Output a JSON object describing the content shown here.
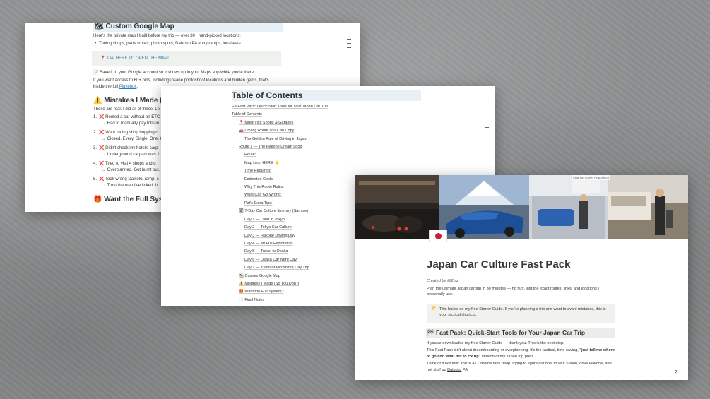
{
  "card1": {
    "heading": "Custom Google Map",
    "heading_icon": "map-icon",
    "intro": "Here's the private map I built before my trip — over 30+ hand-picked locations:",
    "bullet": "Tuning shops, parts stores, photo spots, Daikoku PA entry ramps, local eats",
    "callout_link": "TAP HERE TO OPEN THE MAP!",
    "save_text": "Save it to your Google account so it shows up in your Maps app while you're there.",
    "access_text": "If you want access to 60+ pins, including insane photoshoot locations and hidden gems, that's",
    "access_text2_prefix": "inside the full ",
    "access_link": "Playbook",
    "access_text2_suffix": ".",
    "mistakes_heading": "Mistakes I Made (So",
    "mistakes_intro": "These are real. I did all of these. Le",
    "mistakes": [
      {
        "num": "1.",
        "text": "Rented a car without an ETC",
        "sub": "→ Had to manually pay tolls in"
      },
      {
        "num": "2.",
        "text": "Went tuning shop hopping o",
        "sub": "→ Closed. Every. Single. One. C"
      },
      {
        "num": "3.",
        "text": "Didn't check my hotel's carp",
        "sub": "→ Underground carpark was 1"
      },
      {
        "num": "4.",
        "text": "Tried to visit 4 shops and d",
        "sub": "→ Overplanned. Got burnt out."
      },
      {
        "num": "5.",
        "text": "Took wrong Daikoku ramp, c",
        "sub": "→ Trust the map I've linked. It'"
      }
    ],
    "full_system_heading": "Want the Full Systen"
  },
  "card2": {
    "title": "Table of Contents",
    "items": [
      {
        "text": "🏎 Fast Pack: Quick-Start Tools for Your Japan Car Trip",
        "level": 0
      },
      {
        "text": "Table of Contents",
        "level": 0
      },
      {
        "text": "📍 Must-Visit Shops & Garages",
        "level": 1
      },
      {
        "text": "🚗 Driving Route You Can Copy",
        "level": 1
      },
      {
        "text": "The Golden Rule of Driving in Japan",
        "level": 2
      },
      {
        "text": "Route 1 — The Hakone Dream Loop",
        "level": 1
      },
      {
        "text": "Route:",
        "level": 2
      },
      {
        "text": "Map Link: HERE 👈",
        "level": 2
      },
      {
        "text": "Time Required:",
        "level": 2
      },
      {
        "text": "Estimated Costs:",
        "level": 2
      },
      {
        "text": "Why This Route Rules:",
        "level": 2
      },
      {
        "text": "What Can Go Wrong:",
        "level": 2
      },
      {
        "text": "Pat's Extra Tips:",
        "level": 2
      },
      {
        "text": "🗓 7-Day Car Culture Itinerary (Sample)",
        "level": 1
      },
      {
        "text": "Day 1 — Land in Tokyo",
        "level": 2
      },
      {
        "text": "Day 2 — Tokyo Car Culture",
        "level": 2
      },
      {
        "text": "Day 3 — Hakone Driving Day",
        "level": 2
      },
      {
        "text": "Day 4 — Mt Fuji Exploration",
        "level": 2
      },
      {
        "text": "Day 5 — Travel to Osaka",
        "level": 2
      },
      {
        "text": "Day 6 — Osaka Car Nerd Day",
        "level": 2
      },
      {
        "text": "Day 7 — Kyoto or Hiroshima Day Trip",
        "level": 2
      },
      {
        "text": "🗺 Custom Google Map",
        "level": 1
      },
      {
        "text": "⚠️ Mistakes I Made (So You Don't)",
        "level": 1
      },
      {
        "text": "🎁 Want the Full System?",
        "level": 1
      },
      {
        "text": "📄 Final Notes",
        "level": 1
      }
    ]
  },
  "card3": {
    "cover_buttons": {
      "change": "Change cover",
      "reposition": "Reposition"
    },
    "title": "Japan Car Culture Fast Pack",
    "created_by": "Created by @2pjz_",
    "subtitle": "Plan the ultimate Japan car trip in 30 minutes — no fluff, just the exact routes, links, and locations I personally use.",
    "callout": "This builds on my free Starter Guide. If you're planning a trip and want to avoid mistakes, this is your tactical shortcut.",
    "callout_icon": "pointing-hand-icon",
    "section_heading": "Fast Pack: Quick-Start Tools for Your Japan Car Trip",
    "section_icon": "checkered-flag-icon",
    "p1": "If you've downloaded my free Starter Guide — thank you. This is the next step.",
    "p2_a": "This Fast Pack isn't about ",
    "p2_dream": "dreamboarding",
    "p2_b": " or overplanning. It's the tactical, time-saving, ",
    "p2_bold": "\"just tell me where to go and what not to f*k up\"",
    "p2_c": " version of my Japan trip prep.",
    "p3_a": "Think of it like this: You're 47 Chrome tabs deep, trying to figure out how to visit Spoon, drive Hakone, and not stuff up ",
    "p3_daikoku": "Daikoku",
    "p3_b": " PA.",
    "help_glyph": "?"
  }
}
